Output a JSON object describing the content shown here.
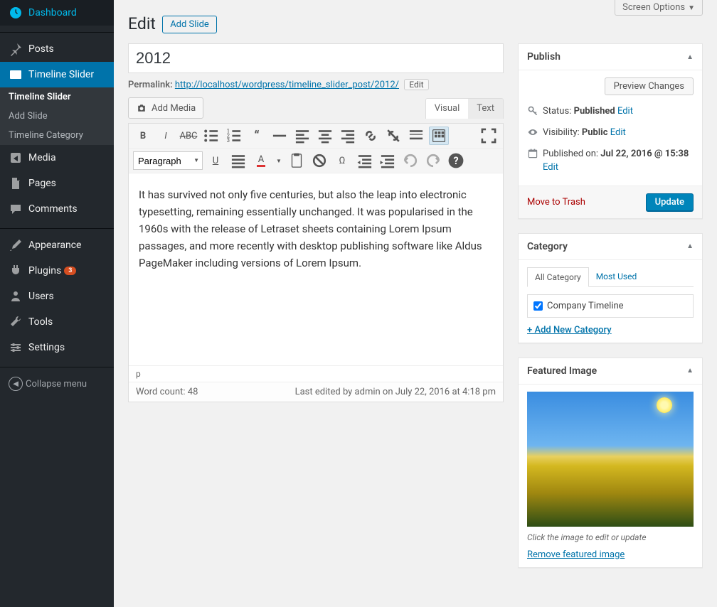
{
  "screen_options": "Screen Options",
  "sidebar": {
    "items": [
      {
        "label": "Dashboard"
      },
      {
        "label": "Posts"
      },
      {
        "label": "Timeline Slider"
      },
      {
        "label": "Media"
      },
      {
        "label": "Pages"
      },
      {
        "label": "Comments"
      },
      {
        "label": "Appearance"
      },
      {
        "label": "Plugins",
        "badge": "3"
      },
      {
        "label": "Users"
      },
      {
        "label": "Tools"
      },
      {
        "label": "Settings"
      }
    ],
    "submenu": [
      {
        "label": "Timeline Slider",
        "bold": true
      },
      {
        "label": "Add Slide"
      },
      {
        "label": "Timeline Category"
      }
    ],
    "collapse": "Collapse menu"
  },
  "header": {
    "title": "Edit",
    "action": "Add Slide"
  },
  "post": {
    "title_value": "2012",
    "permalink_label": "Permalink:",
    "permalink_url": "http://localhost/wordpress/timeline_slider_post/2012/",
    "permalink_edit": "Edit"
  },
  "editor": {
    "add_media": "Add Media",
    "tab_visual": "Visual",
    "tab_text": "Text",
    "format_value": "Paragraph",
    "body": "It has survived not only five centuries, but also the leap into electronic typesetting, remaining essentially unchanged. It was popularised in the 1960s with the release of Letraset sheets containing Lorem Ipsum passages, and more recently with desktop publishing software like Aldus PageMaker including versions of Lorem Ipsum.",
    "path": "p",
    "word_count_label": "Word count: 48",
    "last_edited": "Last edited by admin on July 22, 2016 at 4:18 pm"
  },
  "publish": {
    "title": "Publish",
    "preview": "Preview Changes",
    "status_label": "Status:",
    "status_value": "Published",
    "status_edit": "Edit",
    "visibility_label": "Visibility:",
    "visibility_value": "Public",
    "visibility_edit": "Edit",
    "date_label": "Published on:",
    "date_value": "Jul 22, 2016 @ 15:38",
    "date_edit": "Edit",
    "trash": "Move to Trash",
    "update": "Update"
  },
  "category": {
    "title": "Category",
    "tabs": {
      "all": "All Category",
      "most": "Most Used"
    },
    "items": [
      {
        "label": "Company Timeline",
        "checked": true
      }
    ],
    "add_new": "+ Add New Category"
  },
  "featured": {
    "title": "Featured Image",
    "helper": "Click the image to edit or update",
    "remove": "Remove featured image"
  }
}
